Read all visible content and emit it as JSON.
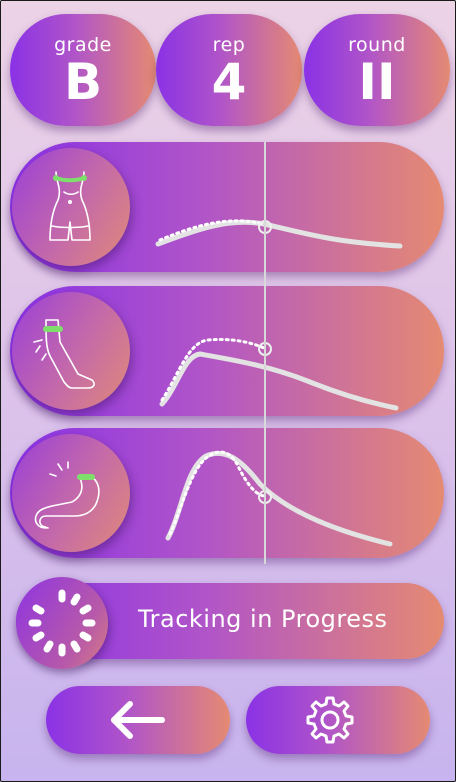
{
  "stats": [
    {
      "label": "grade",
      "value": "B"
    },
    {
      "label": "rep",
      "value": "4"
    },
    {
      "label": "round",
      "value": "II"
    }
  ],
  "rows": [
    {
      "icon": "waist-icon",
      "name": "waist-tracking"
    },
    {
      "icon": "knee-icon",
      "name": "knee-tracking"
    },
    {
      "icon": "arm-icon",
      "name": "arm-tracking"
    }
  ],
  "status": {
    "text": "Tracking in Progress",
    "icon": "loading-spinner-icon"
  },
  "nav": {
    "back_icon": "back-arrow-icon",
    "settings_icon": "gear-icon"
  },
  "colors": {
    "gradient_start": "#8a32e6",
    "gradient_end": "#e58a72",
    "marker": "#7ee06a",
    "curve": "#e3e3e3"
  }
}
